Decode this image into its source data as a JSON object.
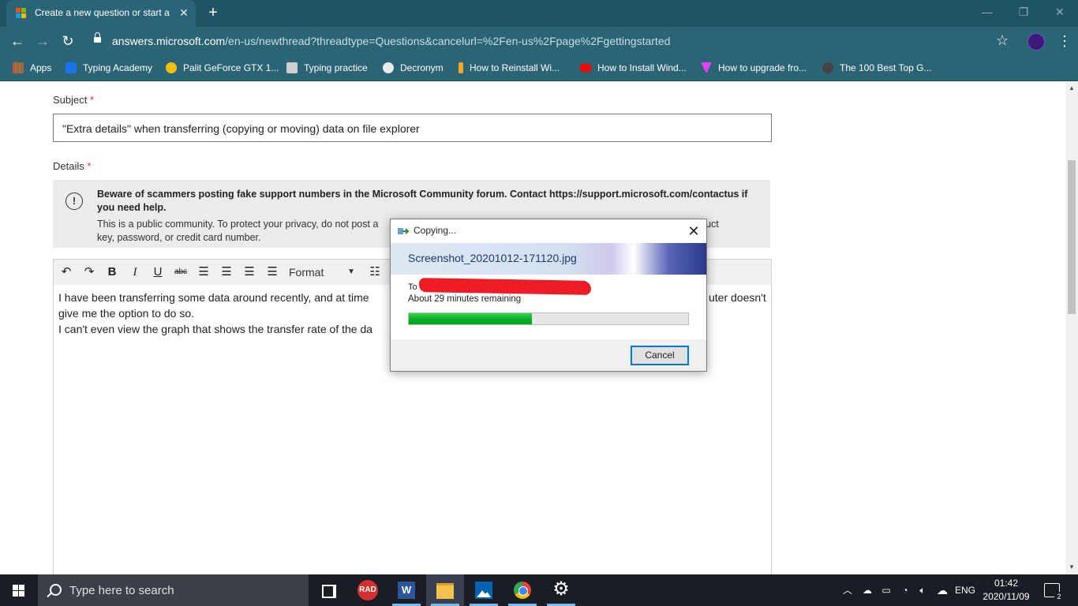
{
  "browser": {
    "tab_title": "Create a new question or start a d",
    "tab_close": "✕",
    "new_tab": "+",
    "url_host": "answers.microsoft.com",
    "url_path": "/en-us/newthread?threadtype=Questions&cancelurl=%2Fen-us%2Fpage%2Fgettingstarted",
    "bookmarks": [
      {
        "label": "Apps",
        "icon": "apps-grid-icon",
        "color": "#ea4335"
      },
      {
        "label": "Typing Academy",
        "icon": "typing-academy-icon",
        "color": "#1a73e8"
      },
      {
        "label": "Palit GeForce GTX 1...",
        "icon": "emoji-icon",
        "color": "#f4c20d"
      },
      {
        "label": "Typing practice",
        "icon": "typing-practice-icon",
        "color": "#cfcfcf"
      },
      {
        "label": "Decronym",
        "icon": "globe-icon",
        "color": "#e8eaed"
      },
      {
        "label": "How to Reinstall Wi...",
        "icon": "reinstall-icon",
        "color": "#f9a825"
      },
      {
        "label": "How to Install Wind...",
        "icon": "youtube-icon",
        "color": "#ff0000"
      },
      {
        "label": "How to upgrade fro...",
        "icon": "verge-icon",
        "color": "#e040fb"
      },
      {
        "label": "The 100 Best Top G...",
        "icon": "site-icon",
        "color": "#444444"
      }
    ]
  },
  "form": {
    "subject_label": "Subject",
    "required_mark": "*",
    "subject_value": "\"Extra details\" when transferring (copying or moving) data  on file explorer",
    "details_label": "Details",
    "warning_bold": "Beware of scammers posting fake support numbers in the Microsoft Community forum. Contact https://support.microsoft.com/contactus if you need help.",
    "warning_text_left": "This is a public community. To protect your privacy, do not post a",
    "warning_text_right": "roduct",
    "warning_text_line2": "key, password, or credit card number.",
    "format_label": "Format",
    "body_line1_left": "I have been transferring some data around recently, and at time",
    "body_line1_right": "uter doesn't",
    "body_line2": "give me the option to do so.",
    "body_line3": "I can't even view the graph that shows the transfer rate of the da"
  },
  "dialog": {
    "title": "Copying...",
    "close": "✕",
    "filename": "Screenshot_20201012-171120.jpg",
    "to_label": "To",
    "remaining": "About 29 minutes remaining",
    "progress": 0.44,
    "cancel_label": "Cancel"
  },
  "taskbar": {
    "search_placeholder": "Type here to search",
    "rad_label": "RAD",
    "word_label": "W",
    "language": "ENG",
    "time": "01:42",
    "date": "2020/11/09",
    "notification_count": "2"
  }
}
